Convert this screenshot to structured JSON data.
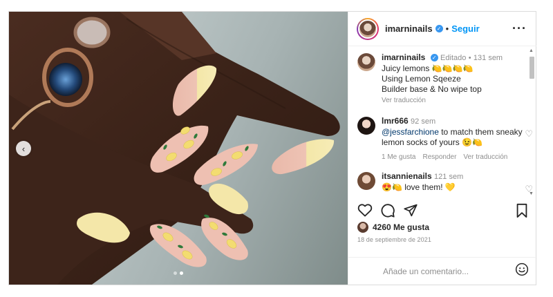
{
  "post": {
    "author": {
      "username": "imarninails",
      "follow_label": "Seguir",
      "separator": "•"
    },
    "caption": {
      "username": "imarninails",
      "edited_label": "Editado",
      "dot": "•",
      "age": "131 sem",
      "lines": [
        "Juicy lemons 🍋🍋🍋🍋",
        "Using Lemon Sqeeze",
        "Builder base & No wipe top"
      ],
      "translate_label": "Ver traducción"
    },
    "comments": [
      {
        "username": "lmr666",
        "age": "92 sem",
        "mention": "@jessfarchione",
        "text": " to match them sneaky lemon socks of yours 😉🍋",
        "likes_label": "1 Me gusta",
        "reply_label": "Responder",
        "translate_label": "Ver traducción"
      },
      {
        "username": "itsannienails",
        "age": "121 sem",
        "text": "😍🍋 love them! 💛"
      }
    ],
    "likes": "4260 Me gusta",
    "date": "18 de septiembre de 2021",
    "comment_placeholder": "Añade un comentario...",
    "carousel": {
      "total": 2,
      "active": 2
    }
  },
  "icons": {
    "more": "more-options-icon",
    "like": "heart-icon",
    "comment": "comment-icon",
    "share": "share-icon",
    "save": "bookmark-icon",
    "emoji": "emoji-icon",
    "verified": "verified-badge-icon",
    "prev": "chevron-left-icon"
  },
  "colors": {
    "link": "#0095f6",
    "verified": "#3897f0",
    "meta": "#8e8e8e",
    "nail_tip": "#f3e6a6",
    "nail_base": "#e8b8a8"
  }
}
